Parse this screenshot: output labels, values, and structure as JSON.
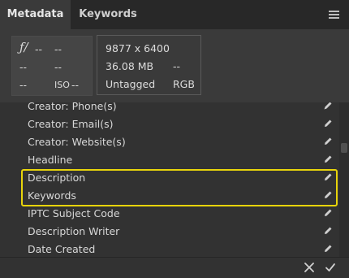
{
  "tabs": [
    {
      "label": "Metadata",
      "active": true
    },
    {
      "label": "Keywords",
      "active": false
    }
  ],
  "camera": {
    "aperture": "--",
    "shutter": "--",
    "focal": "--",
    "exposure": "--",
    "r3c1": "--",
    "iso_label": "ISO",
    "iso_value": "--"
  },
  "file": {
    "dimensions": "9877 x 6400",
    "size": "36.08 MB",
    "size_extra": "--",
    "tag": "Untagged",
    "mode": "RGB"
  },
  "fields": [
    "Creator: Phone(s)",
    "Creator: Email(s)",
    "Creator: Website(s)",
    "Headline",
    "Description",
    "Keywords",
    "IPTC Subject Code",
    "Description Writer",
    "Date Created"
  ],
  "colors": {
    "highlight": "#e8d40b",
    "panel": "#323232"
  },
  "icons": {
    "edit": "pencil-icon",
    "cancel": "close-icon",
    "apply": "checkmark-icon",
    "menu": "hamburger-icon"
  }
}
